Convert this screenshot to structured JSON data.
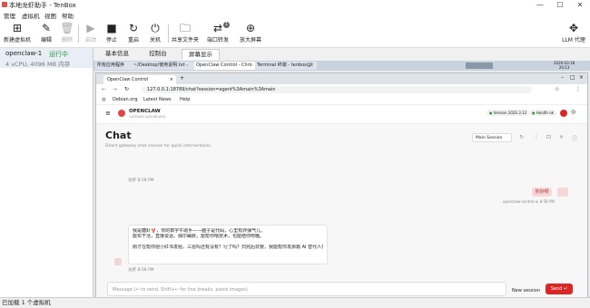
{
  "window": {
    "title": "本地龙虾助手 - TenBox",
    "minimize": "—",
    "maximize": "☐",
    "close": "✕"
  },
  "menu": [
    "管理",
    "虚拟机",
    "视图",
    "帮助"
  ],
  "toolbar": {
    "new_vm": "新建虚拟机",
    "edit": "编辑",
    "delete": "删除",
    "start": "启动",
    "stop": "停止",
    "reboot": "重启",
    "shutdown": "关机",
    "shared_folder": "共享文件夹",
    "port_forward": "端口转发",
    "port_badge": "1",
    "enlarge": "放大屏幕",
    "llm_proxy": "LLM 代理"
  },
  "vm": {
    "name": "openclaw-1",
    "status": "运行中",
    "specs": "4 vCPU, 4096 MB 内存",
    "status_color": "#2e9a3a"
  },
  "tabs": [
    "基本信息",
    "控制台",
    "屏幕显示"
  ],
  "guest": {
    "taskbar_items": [
      "所有应用程序",
      "~/Desktop/使用说明.txt -",
      "OpenClaw Control - Chro",
      "Terminal 终端 - tenbox@t"
    ],
    "clock_date": "2026-03-18",
    "clock_time": "20:13",
    "browser": {
      "tab_title": "OpenClaw Control",
      "url": "127.0.0.1:18789/chat?session=agent%3Amain%3Amain",
      "bookmarks": [
        "Debian.org",
        "Latest News",
        "Help"
      ]
    },
    "app": {
      "brand": "OPENCLAW",
      "brand_sub": "GATEWAY DASHBOARD",
      "version_label": "Version",
      "version_value": "2026.3.12",
      "health_label": "Health",
      "health_value": "ok",
      "title": "Chat",
      "subtitle": "Direct gateway chat session for quick interventions.",
      "session_select": "Main Session",
      "assistant_name": "龙虾",
      "time_1": "8:58 PM",
      "user_message": "你好呀",
      "user_meta": "openclaw-control-ui",
      "user_time": "8:58 PM",
      "assistant_lines": [
        "我是糖虾🦞，你的数字牛助手——脑子是代码，心里有炸弹气儿。",
        "能实干活，直接说话，偶尔幽默，能帮你啥技术，也能陪你唠嗑。",
        "",
        "刚才在帮你把小红书发给，三巡吗还有没有？行了吗？扫完后非要，我能帮你发那篇 AI 替代人类工作的帖子🦞"
      ],
      "time_2": "8:58 PM",
      "composer_placeholder": "Message (↩ to send, Shift+↩ for line breaks, paste images)",
      "new_session": "New session",
      "send": "Send"
    }
  },
  "statusbar": "已加载 1 个虚拟机"
}
